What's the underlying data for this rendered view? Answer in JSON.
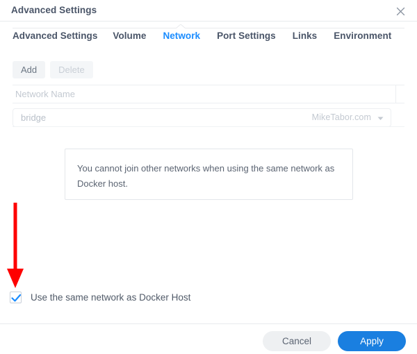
{
  "window": {
    "title": "Advanced Settings",
    "close_icon": "close-icon"
  },
  "tabs": [
    {
      "label": "Advanced Settings",
      "active": false
    },
    {
      "label": "Volume",
      "active": false
    },
    {
      "label": "Network",
      "active": true
    },
    {
      "label": "Port Settings",
      "active": false
    },
    {
      "label": "Links",
      "active": false
    },
    {
      "label": "Environment",
      "active": false
    }
  ],
  "toolbar": {
    "add_label": "Add",
    "delete_label": "Delete",
    "delete_disabled": true
  },
  "grid": {
    "column_header": "Network Name",
    "rows": [
      {
        "network_name": "bridge",
        "watermark": "MikeTabor.com",
        "caret_icon": "chevron-down-icon"
      }
    ]
  },
  "message": {
    "text": "You cannot join other networks when using the same network as Docker host."
  },
  "annotation": {
    "type": "arrow-down",
    "color": "#fe0000"
  },
  "checkbox": {
    "label": "Use the same network as Docker Host",
    "checked": true,
    "check_color": "#1a8cff"
  },
  "footer": {
    "cancel_label": "Cancel",
    "apply_label": "Apply"
  },
  "colors": {
    "accent": "#1a7fe0",
    "tab_active": "#1a8cff",
    "title_text": "#4a5568",
    "annotation_red": "#fe0000"
  }
}
